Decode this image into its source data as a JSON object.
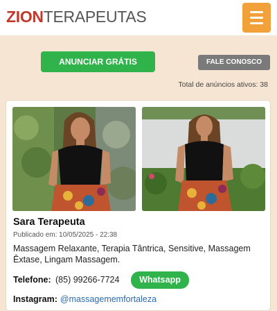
{
  "header": {
    "brand_bold": "ZION",
    "brand_rest": "TERAPEUTAS",
    "menu_icon": "hamburger-menu-icon"
  },
  "actions": {
    "anunciar_label": "ANUNCIAR GRÁTIS",
    "fale_label": "FALE CONOSCO"
  },
  "listing_summary": {
    "total_label": "Total de anúncios ativos: 38"
  },
  "card": {
    "name": "Sara Terapeuta",
    "published": "Publicado em: 10/05/2025 - 22:38",
    "description": "Massagem Relaxante, Terapia Tântrica, Sensitive, Massagem Êxtase, Lingam Massagem.",
    "phone_label": "Telefone:",
    "phone_value": "(85) 99266-7724",
    "whatsapp_label": "Whatsapp",
    "instagram_label": "Instagram:",
    "instagram_handle": "@massagememfortaleza"
  },
  "colors": {
    "page_bg": "#f6e5d3",
    "brand_red": "#c0392b",
    "accent_orange": "#f2a03a",
    "green": "#2fb34a",
    "gray_button": "#7a7a7a",
    "link_blue": "#2a6ab0"
  }
}
